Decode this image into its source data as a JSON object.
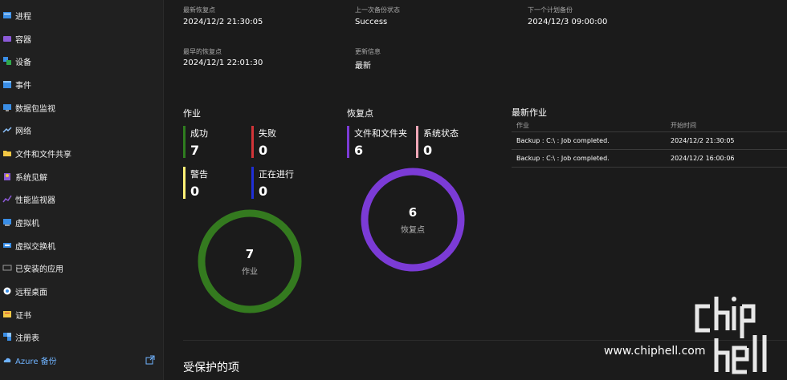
{
  "sidebar": {
    "items": [
      {
        "label": "进程",
        "icon": "processes-icon"
      },
      {
        "label": "容器",
        "icon": "containers-icon"
      },
      {
        "label": "设备",
        "icon": "devices-icon"
      },
      {
        "label": "事件",
        "icon": "events-icon"
      },
      {
        "label": "数据包监视",
        "icon": "packet-monitor-icon"
      },
      {
        "label": "网络",
        "icon": "network-icon"
      },
      {
        "label": "文件和文件共享",
        "icon": "folder-icon"
      },
      {
        "label": "系统见解",
        "icon": "system-insights-icon"
      },
      {
        "label": "性能监视器",
        "icon": "performance-monitor-icon"
      },
      {
        "label": "虚拟机",
        "icon": "virtual-machines-icon"
      },
      {
        "label": "虚拟交换机",
        "icon": "virtual-switch-icon"
      },
      {
        "label": "已安装的应用",
        "icon": "installed-apps-icon"
      },
      {
        "label": "远程桌面",
        "icon": "remote-desktop-icon"
      },
      {
        "label": "证书",
        "icon": "certificates-icon"
      },
      {
        "label": "注册表",
        "icon": "registry-icon"
      },
      {
        "label": "Azure 备份",
        "icon": "azure-backup-icon"
      }
    ]
  },
  "summary": {
    "latest_restore_label": "最新恢复点",
    "latest_restore_value": "2024/12/2 21:30:05",
    "last_backup_status_label": "上一次备份状态",
    "last_backup_status_value": "Success",
    "next_backup_label": "下一个计划备份",
    "next_backup_value": "2024/12/3 09:00:00",
    "earliest_restore_label": "最早的恢复点",
    "earliest_restore_value": "2024/12/1 22:01:30",
    "update_info_label": "更新信息",
    "update_info_value": "最新"
  },
  "jobs": {
    "title": "作业",
    "success_label": "成功",
    "success_value": "7",
    "failed_label": "失败",
    "failed_value": "0",
    "warning_label": "警告",
    "warning_value": "0",
    "in_progress_label": "正在进行",
    "in_progress_value": "0",
    "ring_value": "7",
    "ring_label": "作业",
    "ring_fraction": 1.0
  },
  "recovery_points": {
    "title": "恢复点",
    "files_label": "文件和文件夹",
    "files_value": "6",
    "system_state_label": "系统状态",
    "system_state_value": "0",
    "ring_value": "6",
    "ring_label": "恢复点",
    "ring_fraction": 1.0
  },
  "latest_jobs": {
    "title": "最新作业",
    "columns": [
      "作业",
      "开始时间"
    ],
    "rows": [
      [
        "Backup : C:\\ : Job completed.",
        "2024/12/2 21:30:05"
      ],
      [
        "Backup : C:\\ : Job completed.",
        "2024/12/2 16:00:06"
      ]
    ]
  },
  "protected_items_title": "受保护的项",
  "watermark": {
    "logo_text": "chip hell",
    "url": "www.chiphell.com"
  },
  "colors": {
    "success": "#2f7d1f",
    "failed": "#d13438",
    "warning": "#fff176",
    "in_progress": "#1f2fd6",
    "files": "#7b3bd6",
    "system_state": "#f0a8b8",
    "ring_jobs": "#347a1f",
    "ring_recovery": "#7b3bd6",
    "azure_link": "#6fb3ff"
  }
}
